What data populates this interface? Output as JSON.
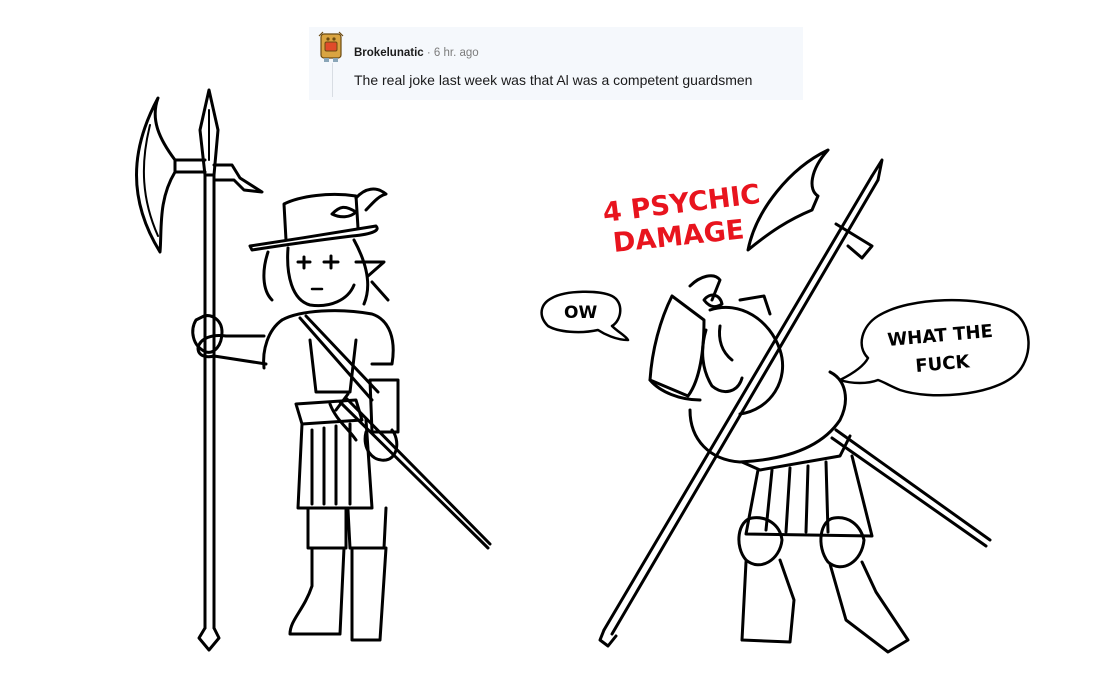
{
  "comment": {
    "username": "Brokelunatic",
    "separator": "·",
    "timestamp": "6 hr. ago",
    "body": "The real joke last week was that Al was a competent guardsmen"
  },
  "comic": {
    "damage_line1": "4 PSYCHIC",
    "damage_line2": "DAMAGE",
    "bubble_ow": "OW",
    "bubble_wtf_line1": "WHAT THE",
    "bubble_wtf_line2": "FUCK",
    "damage_color": "#e8141e"
  }
}
